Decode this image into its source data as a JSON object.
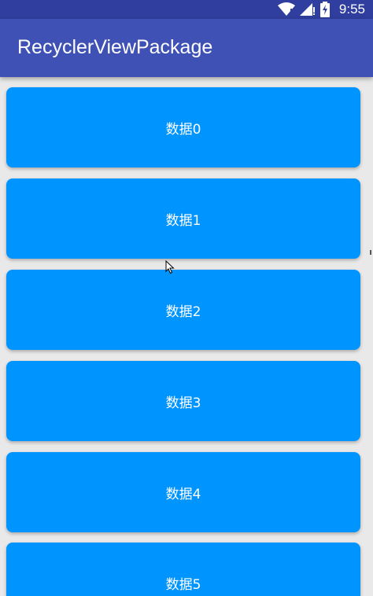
{
  "status_bar": {
    "time": "9:55",
    "icons": [
      "wifi-icon",
      "signal-icon",
      "battery-charging-icon"
    ]
  },
  "app_bar": {
    "title": "RecyclerViewPackage"
  },
  "list": {
    "items": [
      {
        "label": "数据0"
      },
      {
        "label": "数据1"
      },
      {
        "label": "数据2"
      },
      {
        "label": "数据3"
      },
      {
        "label": "数据4"
      },
      {
        "label": "数据5"
      }
    ]
  },
  "colors": {
    "status_bar": "#303f9f",
    "app_bar": "#3f51b5",
    "card": "#0094ff",
    "background": "#e9e9e9"
  }
}
